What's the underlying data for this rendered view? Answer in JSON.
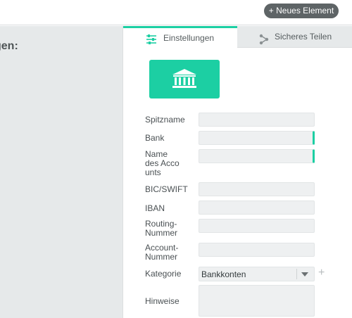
{
  "header": {
    "new_button_label": "+ Neues Element"
  },
  "left_panel": {
    "heading": "gen:"
  },
  "tabs": [
    {
      "label": "Einstellungen",
      "icon": "sliders-icon",
      "active": true
    },
    {
      "label": "Sicheres Teilen",
      "icon": "share-icon",
      "active": false
    }
  ],
  "tile": {
    "icon": "bank-icon",
    "color": "#1ccfa3"
  },
  "form": {
    "spitzname_label": "Spitzname",
    "bank_label": "Bank",
    "account_name_label_1": "Name",
    "account_name_label_2": "des Acco",
    "account_name_label_3": "unts",
    "bic_label": "BIC/SWIFT",
    "iban_label": "IBAN",
    "routing_label_1": "Routing-",
    "routing_label_2": "Nummer",
    "account_number_label_1": "Account-",
    "account_number_label_2": "Nummer",
    "category_label": "Kategorie",
    "category_value": "Bankkonten",
    "notes_label": "Hinweise",
    "add_symbol": "+"
  },
  "colors": {
    "accent": "#1ccfa3",
    "button_bg": "#5e6466"
  }
}
